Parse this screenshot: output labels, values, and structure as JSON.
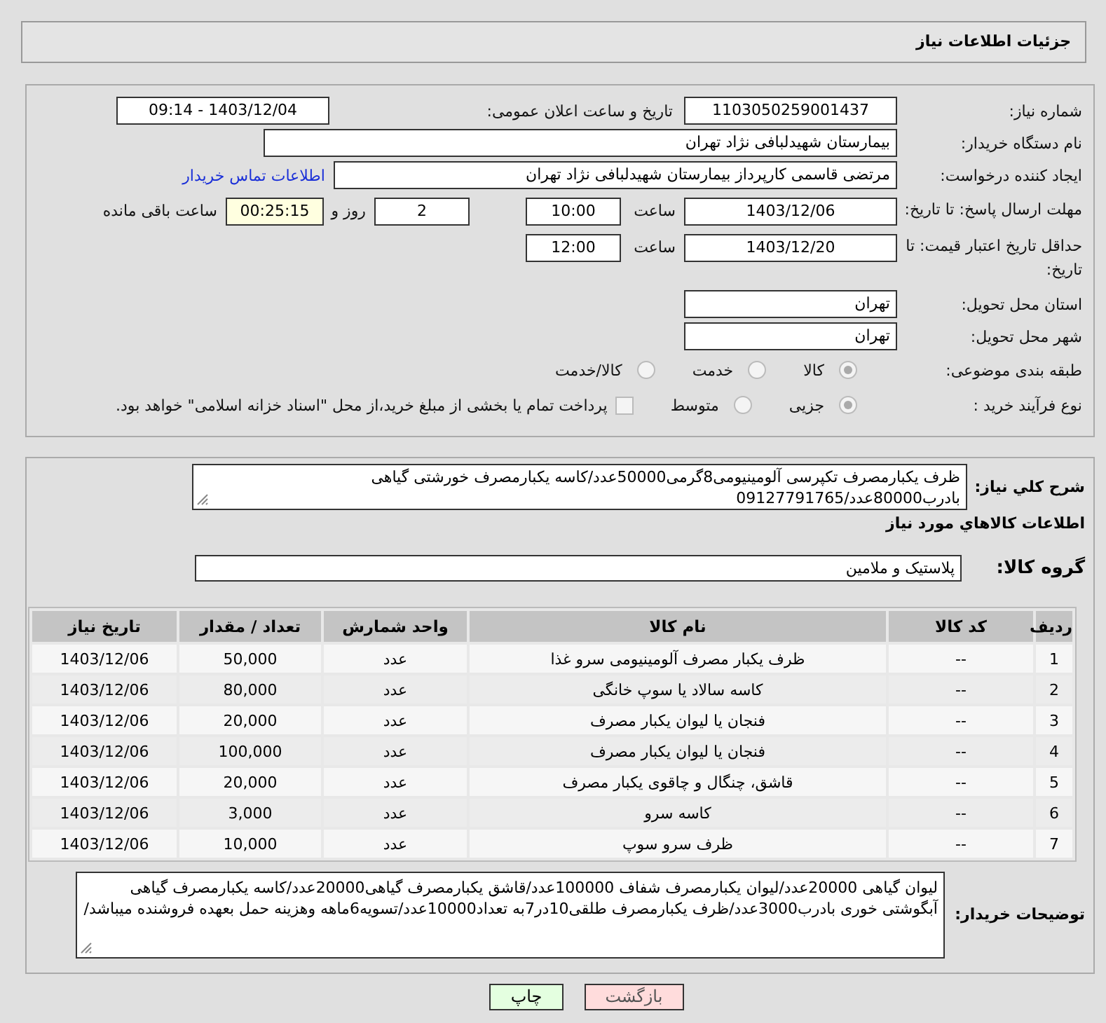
{
  "header": {
    "title": "جزئیات اطلاعات نیاز"
  },
  "info": {
    "need_number": {
      "label": "شماره نیاز:",
      "value": "1103050259001437"
    },
    "announce": {
      "label": "تاریخ و ساعت اعلان عمومی:",
      "value": "1403/12/04 - 09:14"
    },
    "buyer": {
      "label": "نام دستگاه خریدار:",
      "value": "بیمارستان شهیدلبافی نژاد تهران"
    },
    "creator": {
      "label": "ایجاد کننده درخواست:",
      "value": "مرتضی  قاسمی کارپرداز بیمارستان شهیدلبافی نژاد تهران",
      "link": "اطلاعات تماس خریدار"
    },
    "deadline": {
      "label": "مهلت ارسال پاسخ: تا تاریخ:",
      "date": "1403/12/06",
      "time_label": "ساعت",
      "time": "10:00",
      "days": "2",
      "days_label": "روز و",
      "remaining": "00:25:15",
      "remaining_label": "ساعت باقی مانده"
    },
    "validity": {
      "label": "حداقل تاریخ اعتبار قیمت: تا تاریخ:",
      "date": "1403/12/20",
      "time_label": "ساعت",
      "time": "12:00"
    },
    "province": {
      "label": "استان محل تحویل:",
      "value": "تهران"
    },
    "city": {
      "label": "شهر محل تحویل:",
      "value": "تهران"
    },
    "category": {
      "label": "طبقه بندی موضوعی:",
      "options": [
        {
          "label": "کالا",
          "selected": true
        },
        {
          "label": "خدمت",
          "selected": false
        },
        {
          "label": "کالا/خدمت",
          "selected": false
        }
      ]
    },
    "process": {
      "label": "نوع فرآیند خرید :",
      "options": [
        {
          "label": "جزیی",
          "selected": true
        },
        {
          "label": "متوسط",
          "selected": false
        }
      ],
      "treasury": {
        "label": "پرداخت تمام یا بخشی از مبلغ خرید،از محل \"اسناد خزانه اسلامی\" خواهد بود.",
        "checked": false
      }
    }
  },
  "needs": {
    "summary": {
      "label": "شرح کلي نياز:",
      "value": "ظرف یکبارمصرف تکپرسی آلومینیومی8گرمی50000عدد/کاسه یکبارمصرف خورشتی گیاهی بادرب80000عدد/09127791765"
    },
    "items_title": "اطلاعات کالاهاي مورد نياز",
    "group": {
      "label": "گروه کالا:",
      "value": "پلاستیک و ملامین"
    },
    "table": {
      "columns": [
        "ردیف",
        "کد کالا",
        "نام کالا",
        "واحد شمارش",
        "تعداد / مقدار",
        "تاریخ نیاز"
      ],
      "rows": [
        [
          "1",
          "--",
          "ظرف یکبار مصرف آلومینیومی سرو غذا",
          "عدد",
          "50,000",
          "1403/12/06"
        ],
        [
          "2",
          "--",
          "کاسه سالاد یا سوپ خانگی",
          "عدد",
          "80,000",
          "1403/12/06"
        ],
        [
          "3",
          "--",
          "فنجان یا لیوان یکبار مصرف",
          "عدد",
          "20,000",
          "1403/12/06"
        ],
        [
          "4",
          "--",
          "فنجان یا لیوان یکبار مصرف",
          "عدد",
          "100,000",
          "1403/12/06"
        ],
        [
          "5",
          "--",
          "قاشق، چنگال و چاقوی یکبار مصرف",
          "عدد",
          "20,000",
          "1403/12/06"
        ],
        [
          "6",
          "--",
          "کاسه سرو",
          "عدد",
          "3,000",
          "1403/12/06"
        ],
        [
          "7",
          "--",
          "ظرف سرو سوپ",
          "عدد",
          "10,000",
          "1403/12/06"
        ]
      ]
    },
    "buyer_notes": {
      "label": "توضیحات خریدار:",
      "value": "لیوان گیاهی 20000عدد/لیوان یکبارمصرف شفاف 100000عدد/قاشق یکبارمصرف گیاهی20000عدد/کاسه یکبارمصرف گیاهی آبگوشتی خوری بادرب3000عدد/ظرف یکبارمصرف طلقی10در7به تعداد10000عدد/تسویه6ماهه وهزینه حمل بعهده فروشنده میباشد/"
    }
  },
  "buttons": [
    {
      "kind": "back",
      "label": "بازگشت"
    },
    {
      "kind": "print",
      "label": "چاپ"
    }
  ]
}
